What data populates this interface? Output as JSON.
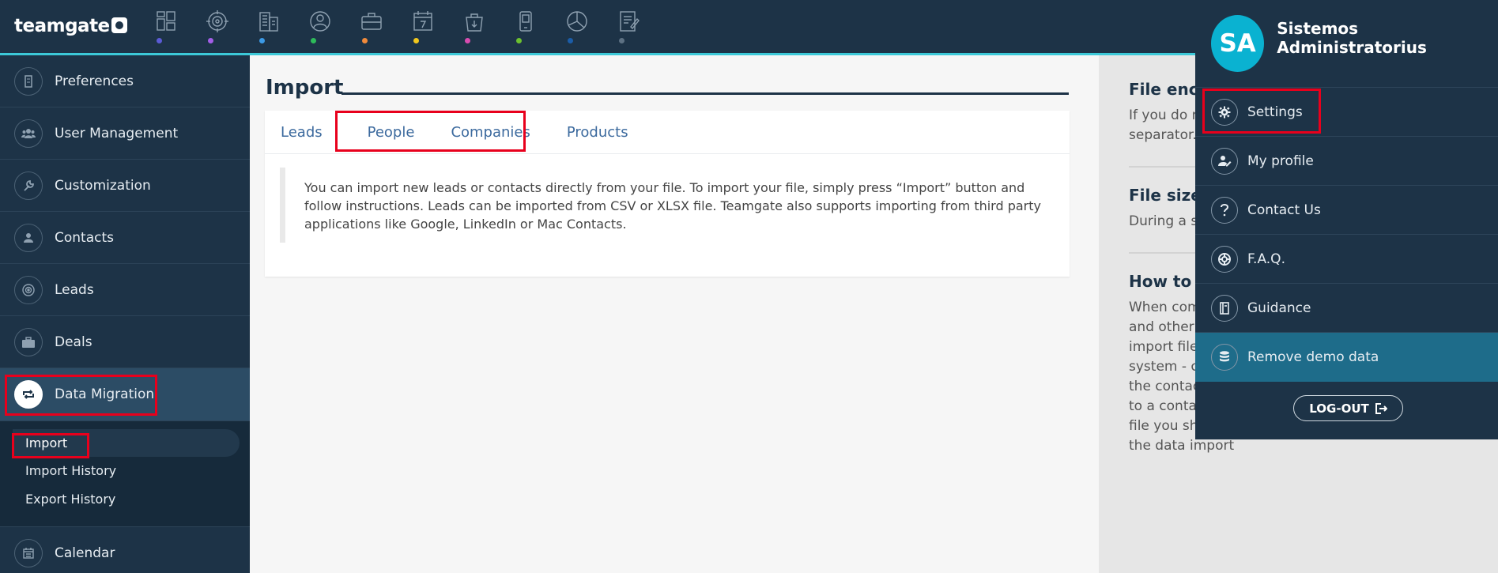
{
  "topbar": {
    "logo": "teamgate",
    "nav": [
      {
        "icon": "dashboard-icon",
        "dot": "#5b5bd6"
      },
      {
        "icon": "target-icon",
        "dot": "#a35ee8"
      },
      {
        "icon": "buildings-icon",
        "dot": "#3c9ae6"
      },
      {
        "icon": "person-icon",
        "dot": "#2dbb5a"
      },
      {
        "icon": "briefcase-icon",
        "dot": "#f08a3b"
      },
      {
        "icon": "calendar-icon",
        "dot": "#f2c81d"
      },
      {
        "icon": "bag-icon",
        "dot": "#d84cb0"
      },
      {
        "icon": "phone-icon",
        "dot": "#6cc12f"
      },
      {
        "icon": "pie-chart-icon",
        "dot": "#1b5da8"
      },
      {
        "icon": "document-icon",
        "dot": "#5d7183"
      }
    ]
  },
  "sidebar": {
    "items": [
      {
        "label": "Preferences",
        "icon": "building-icon"
      },
      {
        "label": "User Management",
        "icon": "users-icon"
      },
      {
        "label": "Customization",
        "icon": "wrench-icon"
      },
      {
        "label": "Contacts",
        "icon": "contact-icon"
      },
      {
        "label": "Leads",
        "icon": "target-icon"
      },
      {
        "label": "Deals",
        "icon": "briefcase-icon"
      },
      {
        "label": "Data Migration",
        "icon": "sync-icon"
      }
    ],
    "sub_items": [
      {
        "label": "Import"
      },
      {
        "label": "Import History"
      },
      {
        "label": "Export History"
      }
    ],
    "bottom_item": {
      "label": "Calendar",
      "icon": "calendar-icon"
    }
  },
  "main": {
    "title": "Import",
    "tabs": [
      "Leads",
      "People",
      "Companies",
      "Products"
    ],
    "description": "You can import new leads or contacts directly from your file. To import your file, simply press “Import” button and follow instructions. Leads can be imported from CSV or XLSX file. Teamgate also supports importing from third party applications like Google, LinkedIn or Mac Contacts."
  },
  "help": {
    "s1_title": "File enco",
    "s1_text": "If you do n when savin encoding. rows sepa separator.",
    "s2_title": "File size",
    "s2_text": "During a s upload no During a s recommen",
    "s3_title": "How to u details in",
    "s3_text": "When company’s name, contact person’s name and other details are entered in a single row of import file, two entries will be created in the system - company and contact. If you are willing the contact details and attributes to be imported to a contact and an account, then in your import file you should duplicate these columns. During the data import"
  },
  "user_menu": {
    "initials": "SA",
    "name": "Sistemos Administratorius",
    "items": [
      {
        "label": "Settings",
        "icon": "gear-icon"
      },
      {
        "label": "My profile",
        "icon": "user-edit-icon"
      },
      {
        "label": "Contact Us",
        "icon": "question-icon"
      },
      {
        "label": "F.A.Q.",
        "icon": "lifebuoy-icon"
      },
      {
        "label": "Guidance",
        "icon": "book-icon"
      },
      {
        "label": "Remove demo data",
        "icon": "database-icon"
      }
    ],
    "logout": "LOG-OUT"
  }
}
